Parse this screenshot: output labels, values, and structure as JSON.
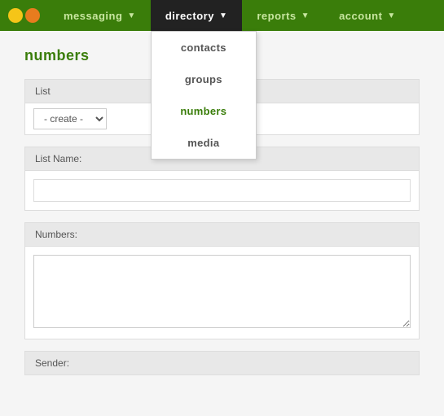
{
  "nav": {
    "brand_circles": [
      "yellow",
      "orange"
    ],
    "items": [
      {
        "id": "messaging",
        "label": "messaging",
        "active": false
      },
      {
        "id": "directory",
        "label": "directory",
        "active": true
      },
      {
        "id": "reports",
        "label": "reports",
        "active": false
      },
      {
        "id": "account",
        "label": "account",
        "active": false
      }
    ],
    "dropdown": {
      "parent": "directory",
      "items": [
        {
          "id": "contacts",
          "label": "contacts"
        },
        {
          "id": "groups",
          "label": "groups"
        },
        {
          "id": "numbers",
          "label": "numbers",
          "active": true
        },
        {
          "id": "media",
          "label": "media"
        }
      ]
    }
  },
  "page": {
    "title": "numbers"
  },
  "form": {
    "list_section_label": "List",
    "list_select_default": "- create -",
    "list_name_label": "List Name:",
    "list_name_placeholder": "",
    "numbers_label": "Numbers:",
    "numbers_placeholder": "",
    "sender_label": "Sender:"
  }
}
